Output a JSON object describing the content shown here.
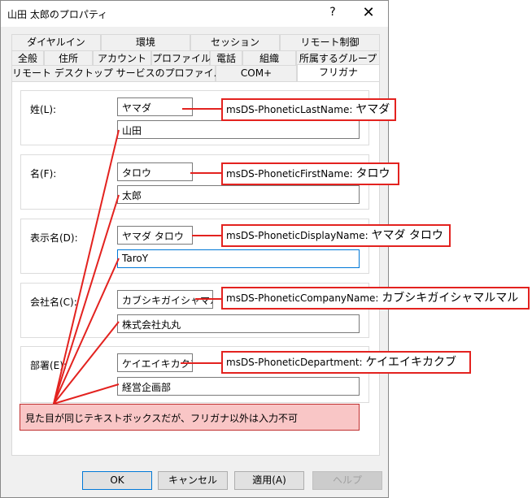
{
  "window": {
    "title": "山田 太郎のプロパティ",
    "help": "?",
    "close": "✕"
  },
  "tabs": {
    "row1": [
      "ダイヤルイン",
      "環境",
      "セッション",
      "リモート制御"
    ],
    "row2": [
      "全般",
      "住所",
      "アカウント",
      "プロファイル",
      "電話",
      "組織",
      "所属するグループ"
    ],
    "row3": [
      "リモート デスクトップ サービスのプロファイル",
      "COM+",
      "フリガナ"
    ]
  },
  "fields": [
    {
      "label": "姓(L):",
      "phonetic": "ヤマダ",
      "value": "山田"
    },
    {
      "label": "名(F):",
      "phonetic": "タロウ",
      "value": "太郎"
    },
    {
      "label": "表示名(D):",
      "phonetic": "ヤマダ タロウ",
      "value": "TaroY"
    },
    {
      "label": "会社名(C):",
      "phonetic": "カブシキガイシャマルマル",
      "value": "株式会社丸丸"
    },
    {
      "label": "部署(E):",
      "phonetic": "ケイエイキカクブ",
      "value": "経営企画部"
    }
  ],
  "callouts": [
    {
      "attr": "msDS-PhoneticLastName:",
      "value": "ヤマダ"
    },
    {
      "attr": "msDS-PhoneticFirstName:",
      "value": "タロウ"
    },
    {
      "attr": "msDS-PhoneticDisplayName:",
      "value": "ヤマダ タロウ"
    },
    {
      "attr": "msDS-PhoneticCompanyName:",
      "value": "カブシキガイシャマルマル"
    },
    {
      "attr": "msDS-PhoneticDepartment:",
      "value": "ケイエイキカクブ"
    }
  ],
  "note": "見た目が同じテキストボックスだが、フリガナ以外は入力不可",
  "buttons": {
    "ok": "OK",
    "cancel": "キャンセル",
    "apply": "適用(A)",
    "help": "ヘルプ"
  },
  "colors": {
    "annotation": "#e3221f",
    "note_bg": "#f9c6c6",
    "focus": "#0078d7"
  }
}
